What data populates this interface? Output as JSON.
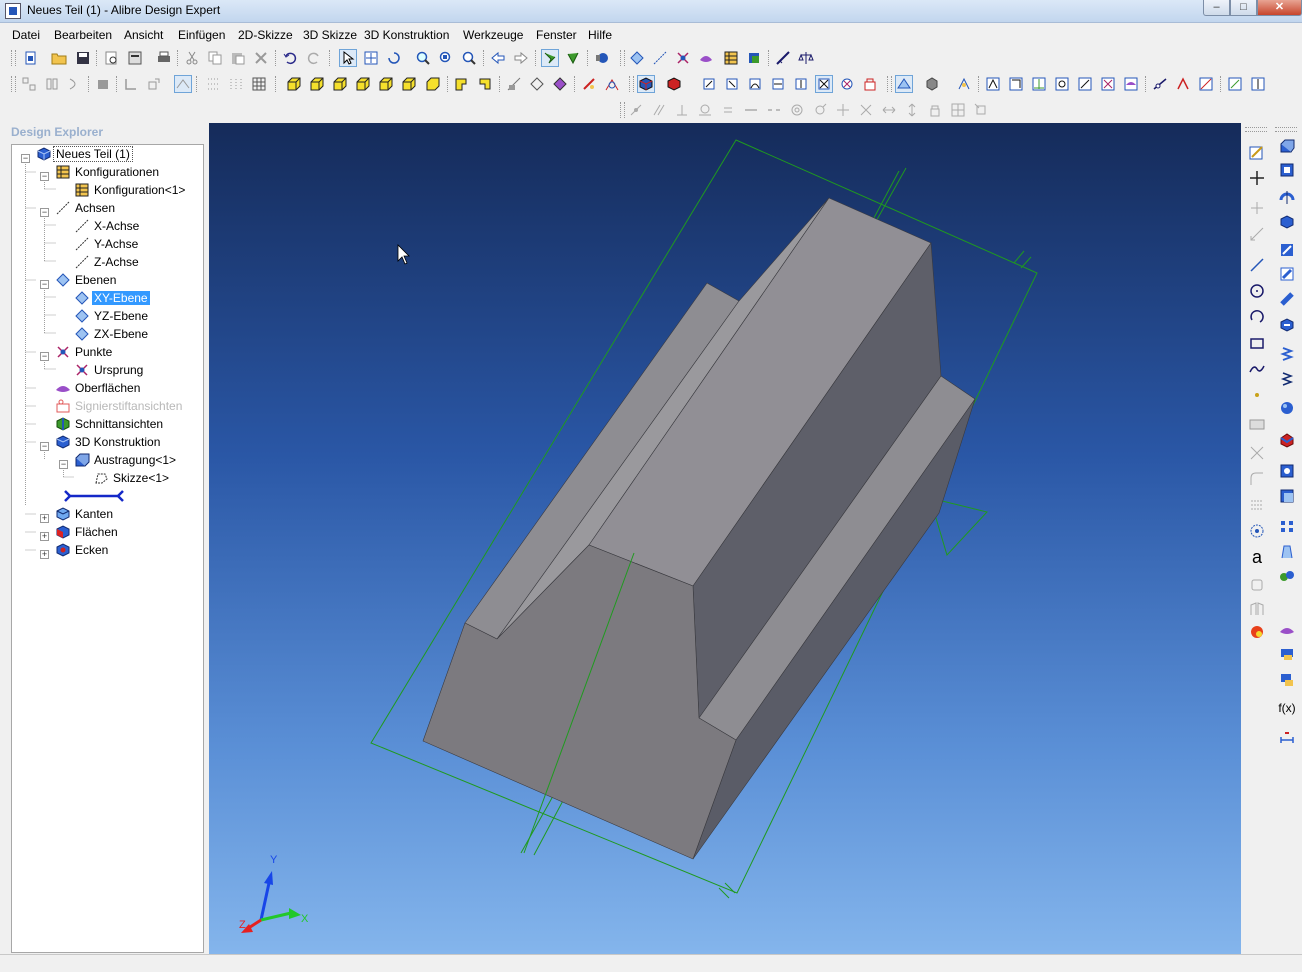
{
  "window": {
    "title": "Neues Teil (1) - Alibre Design Expert",
    "minimize": "–",
    "maximize": "□",
    "close": "✕"
  },
  "menu": {
    "items": [
      "Datei",
      "Bearbeiten",
      "Ansicht",
      "Einfügen",
      "2D-Skizze",
      "3D Skizze",
      "3D Konstruktion",
      "Werkzeuge",
      "Fenster",
      "Hilfe"
    ]
  },
  "explorer": {
    "title": "Design Explorer",
    "nodes": [
      {
        "label": "Neues Teil (1)",
        "icon": "part-icon"
      },
      {
        "label": "Konfigurationen",
        "icon": "configurations-icon"
      },
      {
        "label": "Konfiguration<1>",
        "icon": "configuration-icon"
      },
      {
        "label": "Achsen",
        "icon": "axes-icon"
      },
      {
        "label": "X-Achse",
        "icon": "axis-icon"
      },
      {
        "label": "Y-Achse",
        "icon": "axis-icon"
      },
      {
        "label": "Z-Achse",
        "icon": "axis-icon"
      },
      {
        "label": "Ebenen",
        "icon": "planes-icon"
      },
      {
        "label": "XY-Ebene",
        "icon": "plane-icon"
      },
      {
        "label": "YZ-Ebene",
        "icon": "plane-icon"
      },
      {
        "label": "ZX-Ebene",
        "icon": "plane-icon"
      },
      {
        "label": "Punkte",
        "icon": "points-icon"
      },
      {
        "label": "Ursprung",
        "icon": "origin-icon"
      },
      {
        "label": "Oberflächen",
        "icon": "surfaces-icon"
      },
      {
        "label": "Signierstiftansichten",
        "icon": "redline-icon"
      },
      {
        "label": "Schnittansichten",
        "icon": "section-view-icon"
      },
      {
        "label": "3D Konstruktion",
        "icon": "design-icon"
      },
      {
        "label": "Austragung<1>",
        "icon": "extrusion-icon"
      },
      {
        "label": "Skizze<1>",
        "icon": "sketch-icon"
      },
      {
        "label": "Kanten",
        "icon": "edges-icon"
      },
      {
        "label": "Flächen",
        "icon": "faces-icon"
      },
      {
        "label": "Ecken",
        "icon": "vertices-icon"
      }
    ]
  },
  "viewport": {
    "triad_labels": {
      "y": "Y",
      "x": "X",
      "z": "Z"
    }
  },
  "right_panel": {
    "text_tool": "a",
    "function_tool": "f(x)"
  },
  "colors": {
    "selection": "#3399ff",
    "plane_outline": "#1a9a1a",
    "model_front": "#7c7a7f",
    "model_side": "#5d5f6a",
    "model_top": "#8d8c90"
  }
}
